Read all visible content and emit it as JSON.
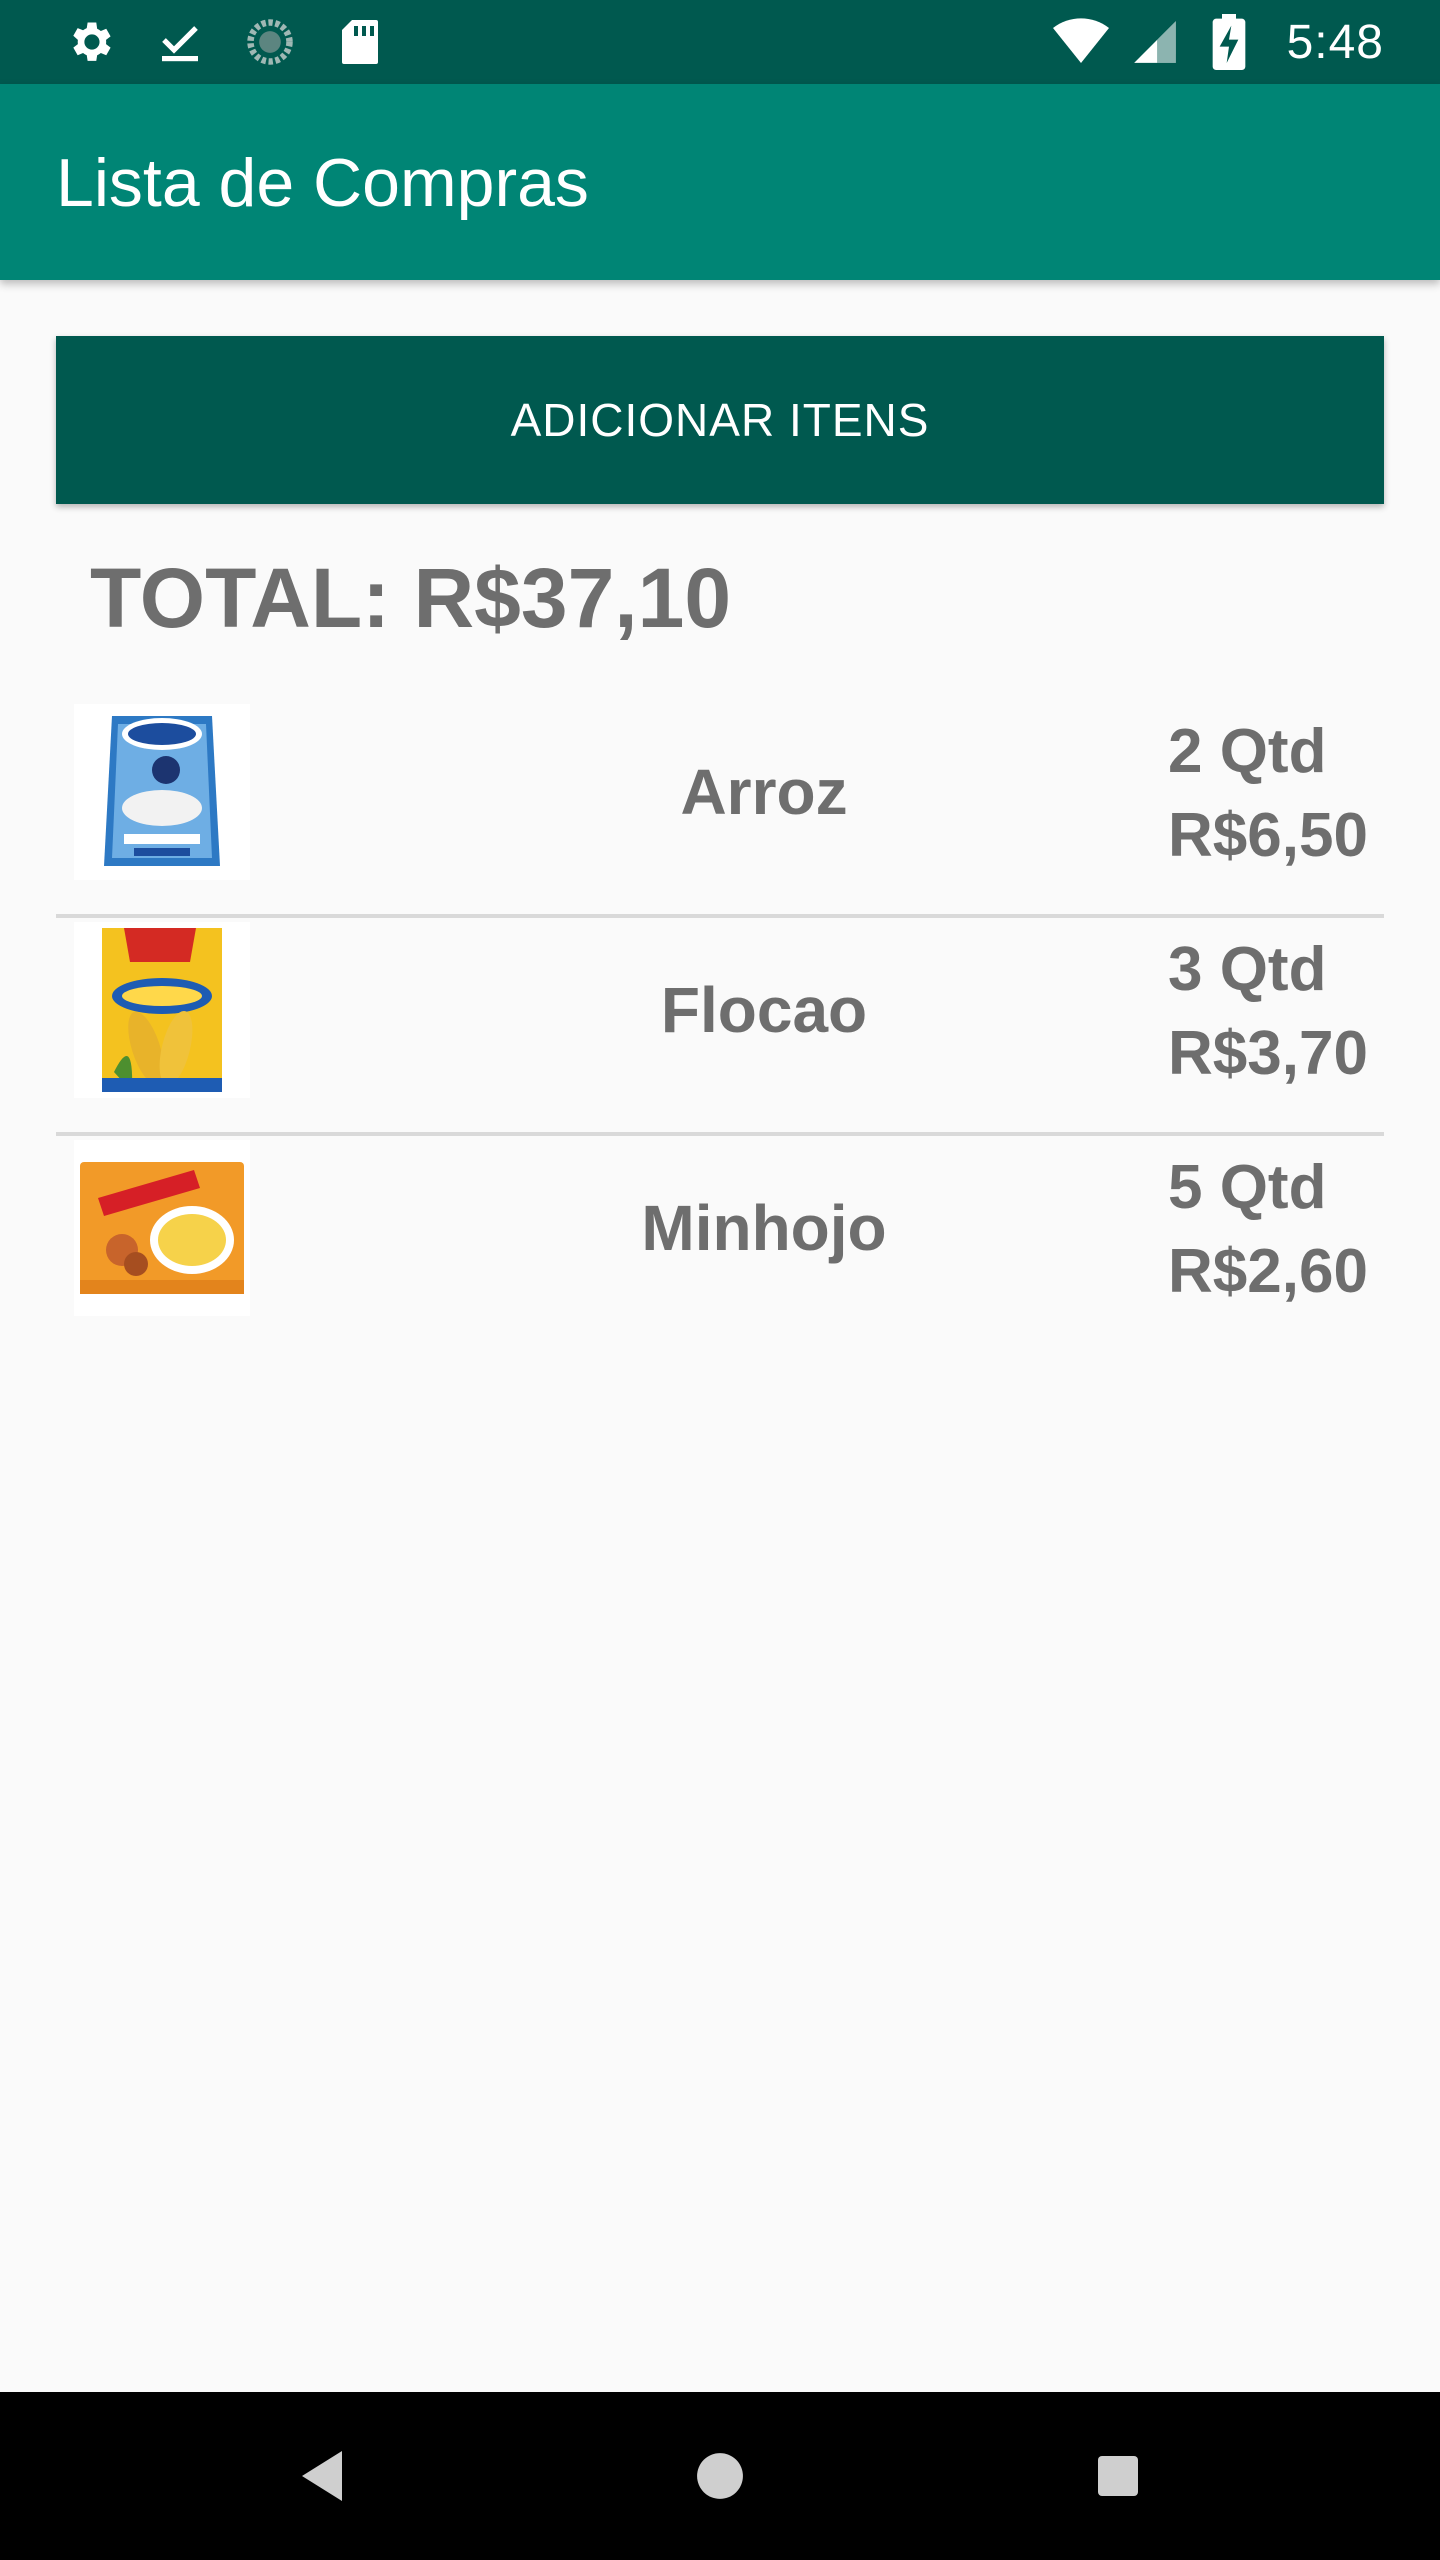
{
  "status_bar": {
    "time": "5:48",
    "left_icons": [
      "gear-icon",
      "download-check-icon",
      "sync-circle-icon",
      "sd-card-icon"
    ],
    "right_icons": [
      "wifi-icon",
      "signal-icon",
      "battery-charging-icon"
    ]
  },
  "app_bar": {
    "title": "Lista de Compras"
  },
  "add_button": {
    "label": "ADICIONAR ITENS"
  },
  "total": {
    "text": "TOTAL: R$37,10"
  },
  "items": [
    {
      "name": "Arroz",
      "qty": "2 Qtd",
      "price": "R$6,50",
      "image": "rice-package"
    },
    {
      "name": "Flocao",
      "qty": "3 Qtd",
      "price": "R$3,70",
      "image": "corn-flakes-package"
    },
    {
      "name": "Minhojo",
      "qty": "5 Qtd",
      "price": "R$2,60",
      "image": "noodle-package"
    }
  ],
  "nav_bar": {
    "buttons": [
      "back-icon",
      "home-icon",
      "recents-icon"
    ]
  },
  "colors": {
    "status_bar": "#00594f",
    "app_bar": "#008575",
    "button": "#00594f",
    "text_gray": "#6e6e6e",
    "background": "#fafafa"
  }
}
